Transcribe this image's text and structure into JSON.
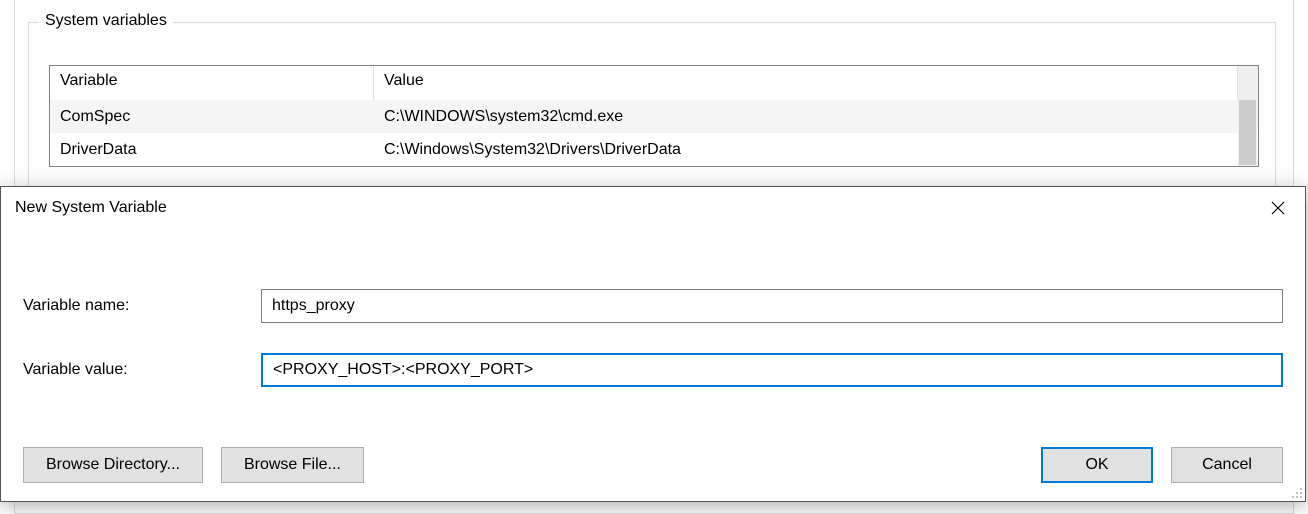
{
  "group": {
    "legend": "System variables",
    "columns": {
      "variable": "Variable",
      "value": "Value"
    },
    "rows": [
      {
        "variable": "ComSpec",
        "value": "C:\\WINDOWS\\system32\\cmd.exe"
      },
      {
        "variable": "DriverData",
        "value": "C:\\Windows\\System32\\Drivers\\DriverData"
      }
    ]
  },
  "dialog": {
    "title": "New System Variable",
    "name_label": "Variable name:",
    "value_label": "Variable value:",
    "name_value": "https_proxy",
    "value_value": "<PROXY_HOST>:<PROXY_PORT>",
    "browse_dir": "Browse Directory...",
    "browse_file": "Browse File...",
    "ok": "OK",
    "cancel": "Cancel"
  }
}
